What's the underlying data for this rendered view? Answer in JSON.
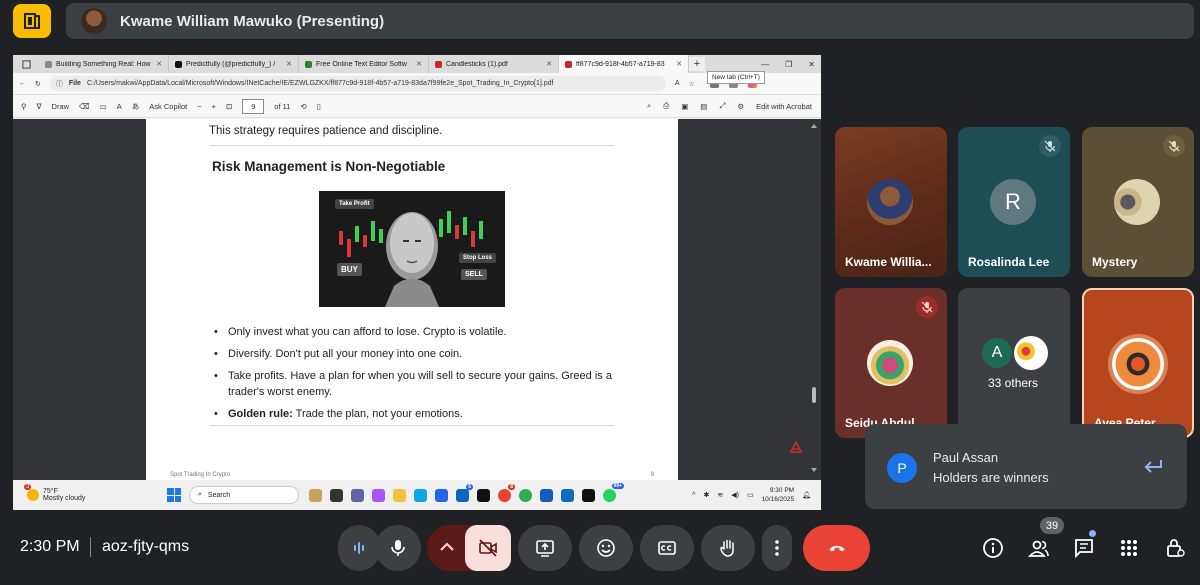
{
  "presenter": {
    "name": "Kwame William Mawuko (Presenting)"
  },
  "browser": {
    "tabs": [
      {
        "label": "Building Something Real: How",
        "fav_color": "#888888"
      },
      {
        "label": "Predictfully (@predictfully_) /",
        "fav_color": "#111111"
      },
      {
        "label": "Free Online Text Editor Softw",
        "fav_color": "#2e7d32"
      },
      {
        "label": "Candlesticks (1).pdf",
        "fav_color": "#c62828"
      },
      {
        "label": "ff877c9d-918f-4b57-a719-83",
        "fav_color": "#c62828"
      }
    ],
    "tooltip": "New tab (Ctrl+T)",
    "address_label": "File",
    "address": "C:/Users/makwi/AppData/Local/Microsoft/Windows/INetCache/IE/EZWLGZKX/ff877c9d-918f-4b57-a719-83da7f99fe2e_Spot_Trading_In_Crypto[1].pdf"
  },
  "pdf_toolbar": {
    "draw": "Draw",
    "copilot": "Ask Copilot",
    "zoom_minus": "−",
    "zoom_plus": "+",
    "page": "9",
    "of": "of 11",
    "edit": "Edit with Acrobat"
  },
  "document": {
    "top_text": "This strategy requires patience and discipline.",
    "heading": "Risk Management is Non-Negotiable",
    "image_labels": {
      "take_profit": "Take Profit",
      "buy": "BUY",
      "stop_loss": "Stop Loss",
      "sell": "SELL"
    },
    "bullets": [
      {
        "bold": "",
        "text": "Only invest what you can afford to lose. Crypto is volatile."
      },
      {
        "bold": "",
        "text": "Diversify. Don't put all your money into one coin."
      },
      {
        "bold": "",
        "text": "Take profits. Have a plan for when you will sell to secure your gains. Greed is a trader's worst enemy."
      },
      {
        "bold": "Golden rule:",
        "text": " Trade the plan, not your emotions."
      }
    ],
    "footer_left": "Spot Trading In Crypto",
    "footer_right": "9"
  },
  "taskbar": {
    "temp": "75°F",
    "condition": "Mostly cloudy",
    "weather_badge": "3",
    "search": "Search",
    "time": "9:30 PM",
    "date": "10/16/2025",
    "linkedin_badge": "6",
    "chrome_badge": "8",
    "whatsapp_badge": "99+"
  },
  "participants": [
    {
      "name": "Kwame Willia...",
      "muted": false
    },
    {
      "name": "Rosalinda Lee",
      "initial": "R",
      "muted": true
    },
    {
      "name": "Mystery",
      "muted": true
    },
    {
      "name": "Seidu Abdul...",
      "muted": true
    },
    {
      "name": "33 others",
      "initial": "A"
    },
    {
      "name": "Ayea Peter",
      "muted": false
    }
  ],
  "notification": {
    "initial": "P",
    "name": "Paul Assan",
    "message": "Holders are winners"
  },
  "bottom": {
    "time": "2:30 PM",
    "code": "aoz-fjty-qms",
    "people_count": "39"
  },
  "colors": {
    "end_call": "#ea4335",
    "active_control": "#f9dedc",
    "accent": "#8ab4f8"
  }
}
